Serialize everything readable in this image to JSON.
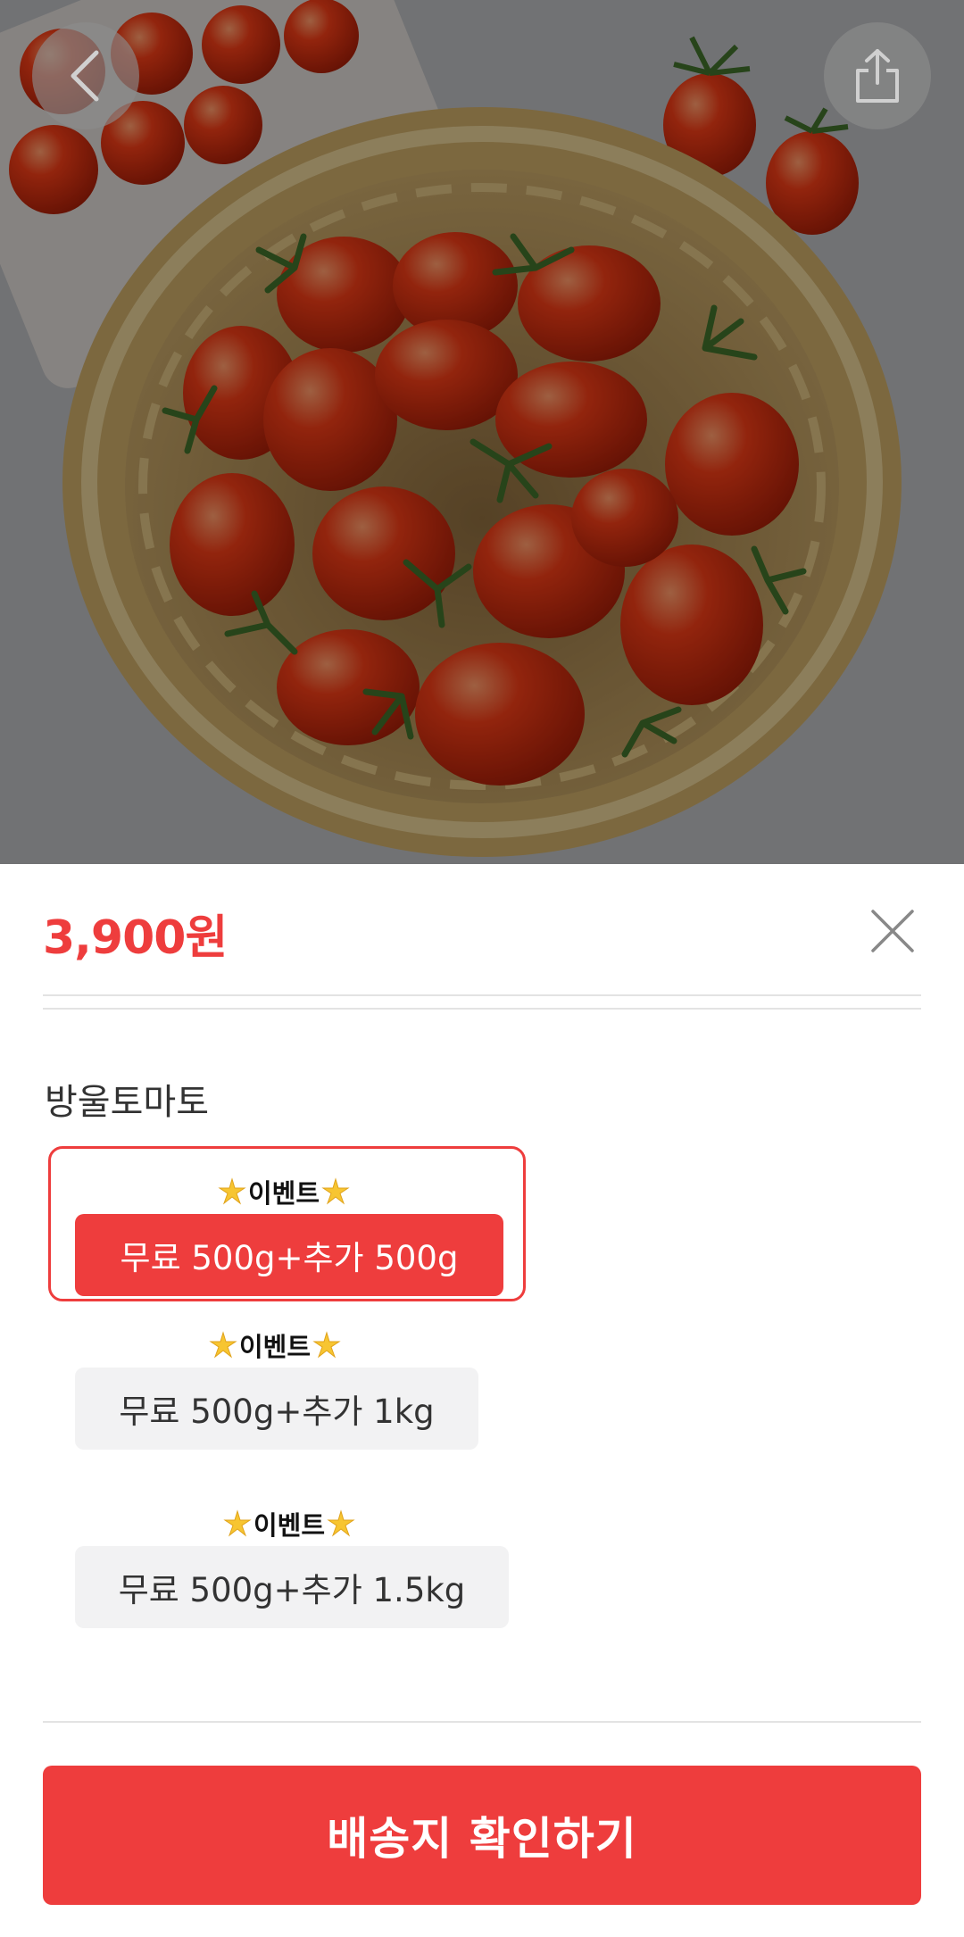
{
  "product": {
    "image_description_icon": "cherry-tomatoes-basket-photo",
    "price": "3,900원"
  },
  "header": {
    "back_icon": "chevron-left-icon",
    "share_icon": "share-icon"
  },
  "option_group": {
    "title": "방울토마토",
    "options": [
      {
        "badge": "이벤트",
        "label": "무료 500g+추가 500g",
        "selected": true
      },
      {
        "badge": "이벤트",
        "label": "무료 500g+추가 1kg",
        "selected": false
      },
      {
        "badge": "이벤트",
        "label": "무료 500g+추가 1.5kg",
        "selected": false
      }
    ]
  },
  "cta": {
    "label": "배송지 확인하기"
  },
  "colors": {
    "accent": "#ee3d3d",
    "chip_bg": "#f2f2f3",
    "divider": "#e3e3e3",
    "text_dark": "#333333"
  }
}
